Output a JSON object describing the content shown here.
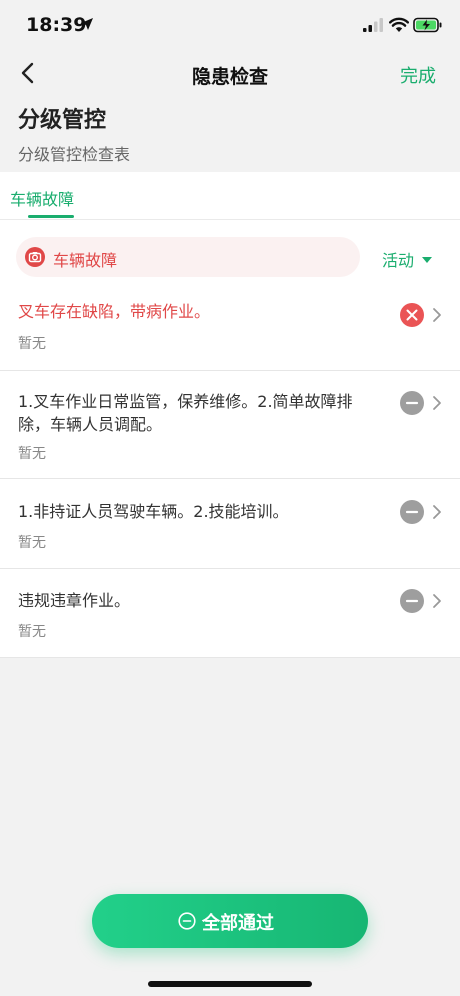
{
  "status_bar": {
    "time": "18:39"
  },
  "nav": {
    "title": "隐患检查",
    "done_label": "完成"
  },
  "page": {
    "title": "分级管控",
    "subtitle": "分级管控检查表"
  },
  "tabs": [
    {
      "label": "车辆故障",
      "active": true
    }
  ],
  "category": {
    "label": "车辆故障",
    "filter_label": "活动"
  },
  "items": [
    {
      "text": "叉车存在缺陷，带病作业。",
      "sub": "暂无",
      "status": "fail"
    },
    {
      "text": "1.叉车作业日常监管，保养维修。2.简单故障排除，车辆人员调配。",
      "sub": "暂无",
      "status": "unchecked"
    },
    {
      "text": "1.非持证人员驾驶车辆。2.技能培训。",
      "sub": "暂无",
      "status": "unchecked"
    },
    {
      "text": "违规违章作业。",
      "sub": "暂无",
      "status": "unchecked"
    }
  ],
  "footer": {
    "pass_all_label": "全部通过"
  },
  "colors": {
    "accent": "#1aad6e",
    "fail": "#e04848",
    "neutral": "#9e9e9e"
  }
}
